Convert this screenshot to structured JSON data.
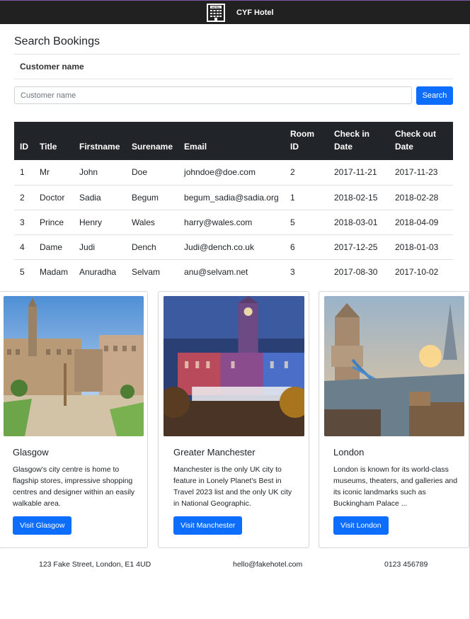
{
  "navbar": {
    "brand": "CYF Hotel",
    "logo_icon": "hotel-building-icon",
    "logo_text": "HOTEL"
  },
  "search": {
    "title": "Search Bookings",
    "field_label": "Customer name",
    "placeholder": "Customer name",
    "value": "",
    "button_label": "Search"
  },
  "table": {
    "headers": [
      "ID",
      "Title",
      "Firstname",
      "Surename",
      "Email",
      "Room ID",
      "Check in Date",
      "Check out Date"
    ],
    "rows": [
      [
        "1",
        "Mr",
        "John",
        "Doe",
        "johndoe@doe.com",
        "2",
        "2017-11-21",
        "2017-11-23"
      ],
      [
        "2",
        "Doctor",
        "Sadia",
        "Begum",
        "begum_sadia@sadia.org",
        "1",
        "2018-02-15",
        "2018-02-28"
      ],
      [
        "3",
        "Prince",
        "Henry",
        "Wales",
        "harry@wales.com",
        "5",
        "2018-03-01",
        "2018-04-09"
      ],
      [
        "4",
        "Dame",
        "Judi",
        "Dench",
        "Judi@dench.co.uk",
        "6",
        "2017-12-25",
        "2018-01-03"
      ],
      [
        "5",
        "Madam",
        "Anuradha",
        "Selvam",
        "anu@selvam.net",
        "3",
        "2017-08-30",
        "2017-10-02"
      ]
    ]
  },
  "cards": [
    {
      "title": "Glasgow",
      "text": "Glasgow's city centre is home to flagship stores, impressive shopping centres and designer within an easily walkable area.",
      "button": "Visit Glasgow",
      "image": "glasgow-city-square-photo"
    },
    {
      "title": "Greater Manchester",
      "text": "Manchester is the only UK city to feature in Lonely Planet's Best in Travel 2023 list and the only UK city in National Geographic.",
      "button": "Visit Manchester",
      "image": "manchester-town-hall-photo"
    },
    {
      "title": "London",
      "text": "London is known for its world-class museums, theaters, and galleries and its iconic landmarks such as Buckingham Palace ...",
      "button": "Visit London",
      "image": "london-tower-bridge-photo"
    }
  ],
  "footer": {
    "address": "123 Fake Street, London, E1 4UD",
    "email": "hello@fakehotel.com",
    "phone": "0123 456789"
  },
  "colors": {
    "primary": "#0d6efd",
    "navbar": "#212121",
    "table_header": "#212529"
  }
}
